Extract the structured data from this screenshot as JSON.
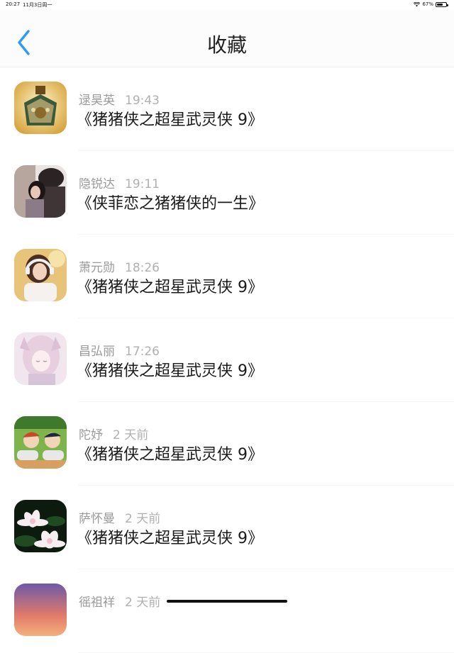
{
  "status_bar": {
    "time": "20:27",
    "date": "11月3日周一",
    "battery": "67%",
    "battery_level": 0.67
  },
  "nav": {
    "title": "收藏"
  },
  "items": [
    {
      "name": "逯昊英",
      "time": "19:43",
      "title": "《猪猪侠之超星武灵侠 9》"
    },
    {
      "name": "隐锐达",
      "time": "19:11",
      "title": "《侠菲恋之猪猪侠的一生》"
    },
    {
      "name": "萧元勋",
      "time": "18:26",
      "title": "《猪猪侠之超星武灵侠 9》"
    },
    {
      "name": "昌弘丽",
      "time": "17:26",
      "title": "《猪猪侠之超星武灵侠 9》"
    },
    {
      "name": "陀妤",
      "time": "2 天前",
      "title": "《猪猪侠之超星武灵侠 9》"
    },
    {
      "name": "萨怀曼",
      "time": "2 天前",
      "title": "《猪猪侠之超星武灵侠 9》"
    },
    {
      "name": "徭祖祥",
      "time": "2 天前",
      "title": ""
    }
  ],
  "colors": {
    "accent": "#2f9bf0"
  }
}
